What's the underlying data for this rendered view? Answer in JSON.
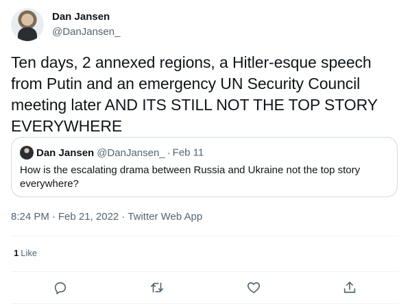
{
  "author": {
    "name": "Dan Jansen",
    "handle": "@DanJansen_"
  },
  "tweet": {
    "text": "Ten days, 2 annexed regions, a Hitler-esque speech from Putin and an emergency UN Security Council meeting later AND ITS STILL NOT THE TOP STORY EVERYWHERE",
    "time": "8:24 PM",
    "date": "Feb 21, 2022",
    "source": "Twitter Web App",
    "separator": "·"
  },
  "quoted_tweet": {
    "name": "Dan Jansen",
    "handle": "@DanJansen_",
    "separator": "·",
    "date": "Feb 11",
    "text": "How is the escalating drama between Russia and Ukraine not the top story everywhere?"
  },
  "stats": {
    "likes_count": "1",
    "likes_label": "Like"
  },
  "actions": {
    "reply_icon": "reply-icon",
    "retweet_icon": "retweet-icon",
    "like_icon": "heart-icon",
    "share_icon": "share-icon"
  },
  "colors": {
    "text_primary": "#0f1419",
    "text_secondary": "#536471",
    "border": "#cfd9de",
    "divider": "#eff3f4"
  }
}
